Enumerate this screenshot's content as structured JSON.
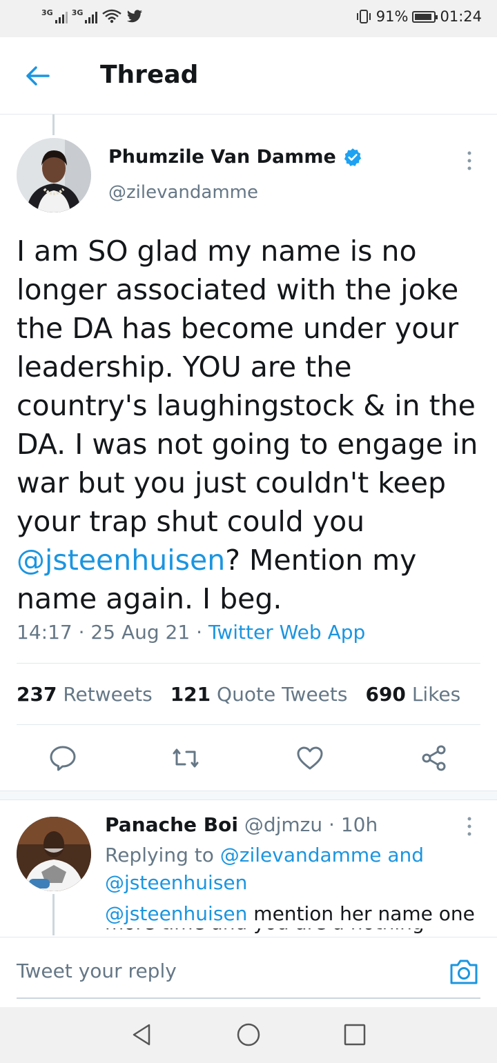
{
  "status_bar": {
    "network_1": "3G",
    "network_2": "3G",
    "battery": "91%",
    "time": "01:24"
  },
  "header": {
    "title": "Thread"
  },
  "main_tweet": {
    "name": "Phumzile Van Damme",
    "handle": "@zilevandamme",
    "text_before": "I am SO glad my name is no longer associated with the joke the DA has become under your leadership. YOU are the country's laughingstock & in the DA. I was not going to engage in war but you just couldn't keep your trap shut could you ",
    "mention": "@jsteenhuisen",
    "text_after": "? Mention my name again. I beg.",
    "time": "14:17",
    "date": "25 Aug 21",
    "source": "Twitter Web App",
    "stats": {
      "retweets_count": "237",
      "retweets_label": "Retweets",
      "quotes_count": "121",
      "quotes_label": "Quote Tweets",
      "likes_count": "690",
      "likes_label": "Likes"
    }
  },
  "reply": {
    "name": "Panache Boi",
    "handle": "@djmzu",
    "time": "10h",
    "replying_label": "Replying to",
    "replying_to_1": "@zilevandamme",
    "and_label": "and",
    "replying_to_2": "@jsteenhuisen",
    "mention": "@jsteenhuisen",
    "text": " mention her name one",
    "text_cut": "more time and you are a nothing"
  },
  "composer": {
    "placeholder": "Tweet your reply"
  },
  "colors": {
    "accent": "#1b95e0",
    "text": "#14171a",
    "muted": "#657786",
    "border": "#e1e8ed"
  },
  "icons": {
    "back": "back-arrow-icon",
    "verified": "verified-badge-icon",
    "more": "more-vertical-icon",
    "reply": "reply-icon",
    "retweet": "retweet-icon",
    "like": "heart-icon",
    "share": "share-icon",
    "camera": "camera-icon"
  }
}
